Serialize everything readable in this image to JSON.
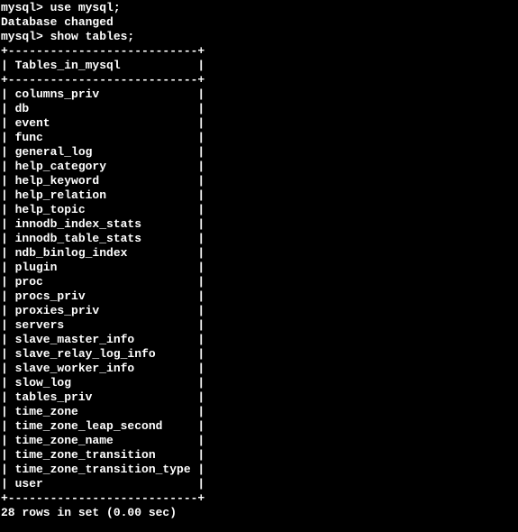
{
  "prompt1": "mysql> ",
  "command1": "use mysql;",
  "response1": "Database changed",
  "prompt2": "mysql> ",
  "command2": "show tables;",
  "border_top": "+---------------------------+",
  "header_line": "| Tables_in_mysql           |",
  "border_mid": "+---------------------------+",
  "rows": [
    "| columns_priv              |",
    "| db                        |",
    "| event                     |",
    "| func                      |",
    "| general_log               |",
    "| help_category             |",
    "| help_keyword              |",
    "| help_relation             |",
    "| help_topic                |",
    "| innodb_index_stats        |",
    "| innodb_table_stats        |",
    "| ndb_binlog_index          |",
    "| plugin                    |",
    "| proc                      |",
    "| procs_priv                |",
    "| proxies_priv              |",
    "| servers                   |",
    "| slave_master_info         |",
    "| slave_relay_log_info      |",
    "| slave_worker_info         |",
    "| slow_log                  |",
    "| tables_priv               |",
    "| time_zone                 |",
    "| time_zone_leap_second     |",
    "| time_zone_name            |",
    "| time_zone_transition      |",
    "| time_zone_transition_type |",
    "| user                      |"
  ],
  "border_bottom": "+---------------------------+",
  "summary": "28 rows in set (0.00 sec)"
}
